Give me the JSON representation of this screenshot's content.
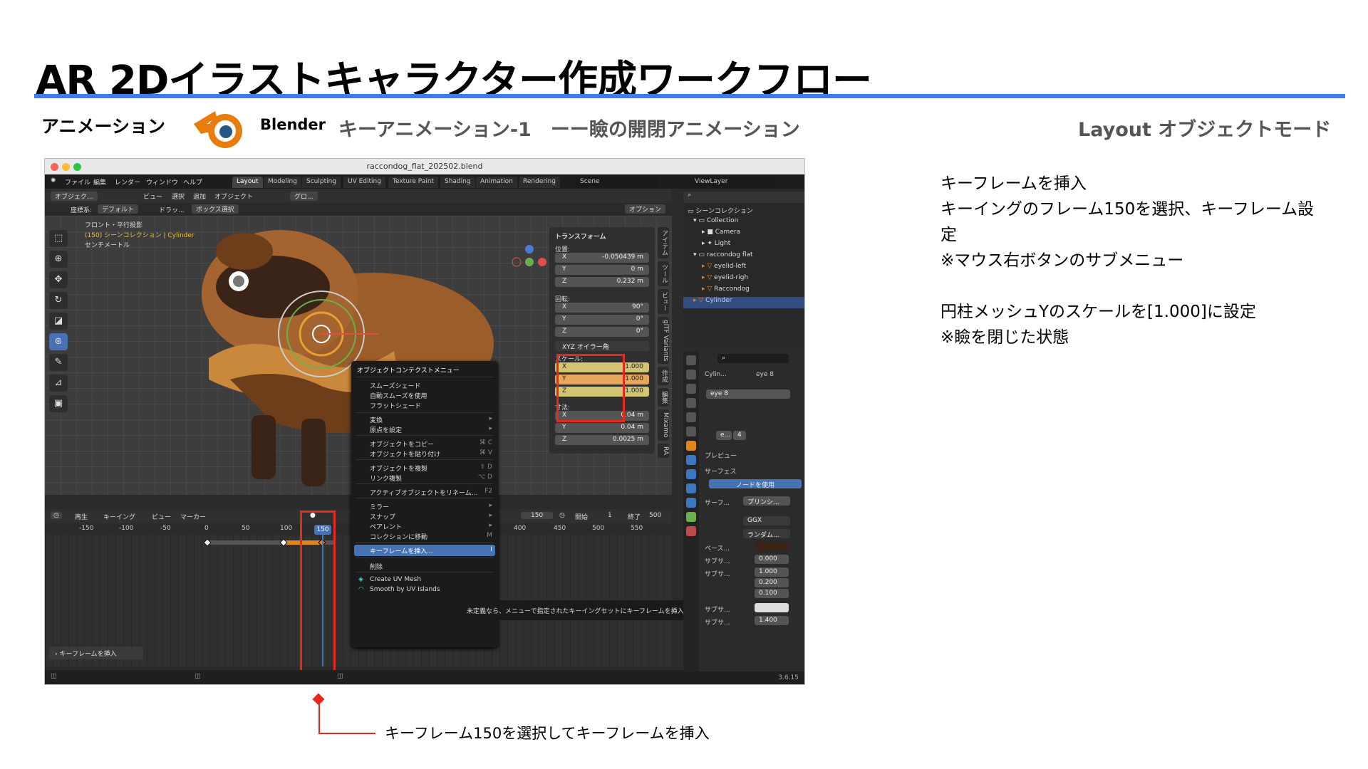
{
  "slide": {
    "title": "AR 2Dイラストキャラクター作成ワークフロー",
    "section": "アニメーション",
    "app": "Blender",
    "subtitle": "キーアニメーション-1　ーー瞼の開閉アニメーション",
    "mode": "Layout オブジェクトモード",
    "description": [
      "キーフレームを挿入",
      "キーイングのフレーム150を選択、キーフレーム設",
      "定",
      "※マウス右ボタンのサブメニュー",
      "",
      "円柱メッシュYのスケールを[1.000]に設定",
      "※瞼を閉じた状態"
    ],
    "callout": "キーフレーム150を選択してキーフレームを挿入",
    "accent_color": "#3a7ee6",
    "highlight_color": "#e8281c"
  },
  "window": {
    "filename": "raccondog_flat_202502.blend",
    "menu": [
      "ファイル",
      "編集",
      "レンダー",
      "ウィンドウ",
      "ヘルプ"
    ],
    "workspaces": [
      "Layout",
      "Modeling",
      "Sculpting",
      "UV Editing",
      "Texture Paint",
      "Shading",
      "Animation",
      "Rendering"
    ],
    "scene": "Scene",
    "viewlayer": "ViewLayer",
    "header": {
      "mode": "オブジェク...",
      "view": "ビュー",
      "select": "選択",
      "add": "追加",
      "object": "オブジェクト",
      "orient": "グロ...",
      "options": "オプション"
    },
    "header2": {
      "coord": "座標系:",
      "default": "デフォルト",
      "drag": "ドラッ...",
      "boxsel": "ボックス選択"
    },
    "overlay": {
      "view": "フロント・平行投影",
      "collection": "(150) シーンコレクション | Cylinder",
      "units": "センチメートル"
    },
    "transform": {
      "title": "トランスフォーム",
      "location_label": "位置:",
      "location": [
        {
          "k": "X",
          "v": "-0.050439 m"
        },
        {
          "k": "Y",
          "v": "0 m"
        },
        {
          "k": "Z",
          "v": "0.232 m"
        }
      ],
      "rotation_label": "回転:",
      "rotation": [
        {
          "k": "X",
          "v": "90°"
        },
        {
          "k": "Y",
          "v": "0°"
        },
        {
          "k": "Z",
          "v": "0°"
        }
      ],
      "euler": "XYZ オイラー角",
      "scale_label": "スケール:",
      "scale": [
        {
          "k": "X",
          "v": "1.000"
        },
        {
          "k": "Y",
          "v": "1.000"
        },
        {
          "k": "Z",
          "v": "1.000"
        }
      ],
      "dim_label": "寸法:",
      "dimensions": [
        {
          "k": "X",
          "v": "0.04 m"
        },
        {
          "k": "Y",
          "v": "0.04 m"
        },
        {
          "k": "Z",
          "v": "0.0025 m"
        }
      ]
    },
    "sidetabs": [
      "アイテム",
      "ツール",
      "ビュー",
      "glTF Variants",
      "作成",
      "編集",
      "Mixamo",
      "RA"
    ],
    "context_menu": {
      "title": "オブジェクトコンテクストメニュー",
      "items": [
        {
          "label": "スムーズシェード",
          "sc": ""
        },
        {
          "label": "自動スムーズを使用",
          "sc": ""
        },
        {
          "label": "フラットシェード",
          "sc": ""
        },
        {
          "label": "変換",
          "sc": "▸"
        },
        {
          "label": "原点を設定",
          "sc": "▸"
        },
        {
          "label": "オブジェクトをコピー",
          "sc": "⌘ C"
        },
        {
          "label": "オブジェクトを貼り付け",
          "sc": "⌘ V"
        },
        {
          "label": "オブジェクトを複製",
          "sc": "⇧ D"
        },
        {
          "label": "リンク複製",
          "sc": "⌥ D"
        },
        {
          "label": "アクティブオブジェクトをリネーム...",
          "sc": "F2"
        },
        {
          "label": "ミラー",
          "sc": "▸"
        },
        {
          "label": "スナップ",
          "sc": "▸"
        },
        {
          "label": "ペアレント",
          "sc": "▸"
        },
        {
          "label": "コレクションに移動",
          "sc": "M"
        },
        {
          "label": "キーフレームを挿入...",
          "sc": "I"
        },
        {
          "label": "削除",
          "sc": ""
        },
        {
          "label": "Create UV Mesh",
          "sc": ""
        },
        {
          "label": "Smooth by UV Islands",
          "sc": ""
        }
      ]
    },
    "tooltip": "未定義なら、メニューで指定されたキーイングセットにキーフレームを挿入します。",
    "timeline": {
      "menus": [
        "再生",
        "キーイング",
        "ビュー",
        "マーカー"
      ],
      "current": "150",
      "start_label": "開始",
      "start": "1",
      "end_label": "終了",
      "end": "500",
      "ruler": [
        "-150",
        "-100",
        "-50",
        "0",
        "50",
        "100",
        "150",
        "400",
        "450",
        "500",
        "550"
      ],
      "keyframes": [
        0,
        100,
        150
      ]
    },
    "last_op": "キーフレームを挿入",
    "version": "3.6.15",
    "outliner": {
      "root": "シーンコレクション",
      "items": [
        "Collection",
        "Camera",
        "Light",
        "raccondog flat",
        "eyelid-left",
        "eyelid-righ",
        "Raccondog",
        "Cylinder"
      ]
    },
    "properties": {
      "crumb1": "Cylin...",
      "crumb2": "eye 8",
      "slot": "eye 8",
      "mat_name": "e...",
      "users": "4",
      "preview": "プレビュー",
      "surface": "サーフェス",
      "use_nodes": "ノードを使用",
      "surface_label": "サーフ...",
      "shader": "プリンシ...",
      "dist": "GGX",
      "random": "ランダム...",
      "base": "ベース...",
      "subsurf": "サブサ...",
      "v1": "0.000",
      "v2": "1.000",
      "v3": "0.200",
      "v4": "0.100",
      "v5": "1.400"
    }
  }
}
